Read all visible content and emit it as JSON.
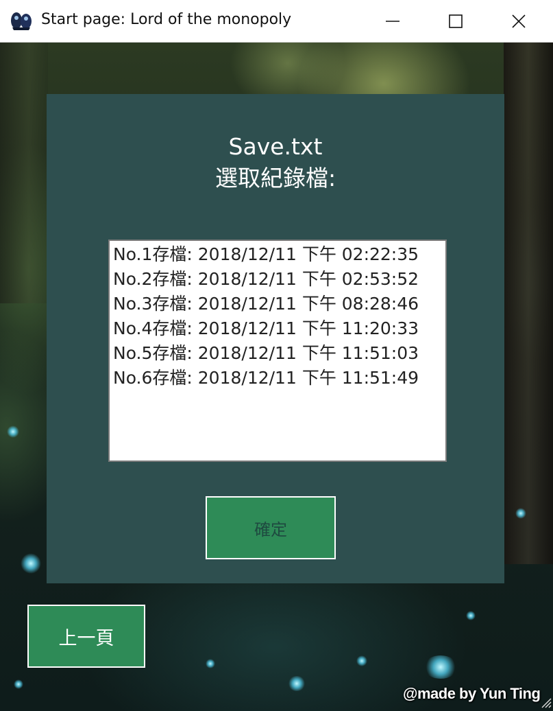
{
  "window": {
    "title": "Start page: Lord of the monopoly",
    "app_icon": "monopoly-logo-icon",
    "controls": {
      "minimize": "minimize-icon",
      "maximize": "maximize-icon",
      "close": "close-icon"
    }
  },
  "dialog": {
    "filename": "Save.txt",
    "prompt": "選取紀錄檔:",
    "save_files": [
      "No.1存檔: 2018/12/11 下午 02:22:35",
      "No.2存檔: 2018/12/11 下午 02:53:52",
      "No.3存檔: 2018/12/11 下午 08:28:46",
      "No.4存檔: 2018/12/11 下午 11:20:33",
      "No.5存檔: 2018/12/11 下午 11:51:03",
      "No.6存檔: 2018/12/11 下午 11:51:49"
    ],
    "confirm_label": "確定"
  },
  "back_label": "上一頁",
  "credit": "@made by Yun Ting",
  "colors": {
    "panel": "#2e4f4f",
    "button": "#2e8b57",
    "confirm_text": "#1e4a40"
  }
}
